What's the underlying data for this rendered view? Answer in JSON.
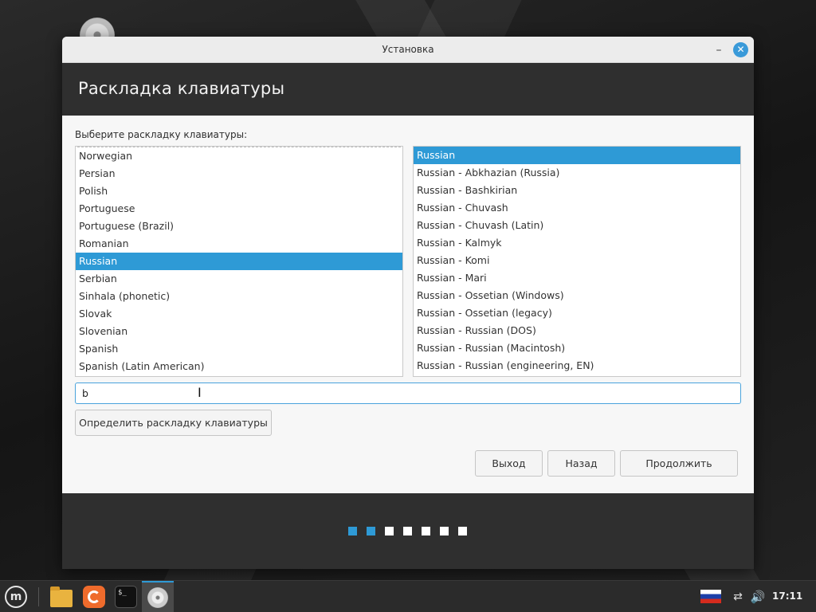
{
  "window": {
    "title": "Установка",
    "minimize_glyph": "–",
    "close_glyph": "✕"
  },
  "header": {
    "title": "Раскладка клавиатуры"
  },
  "content": {
    "prompt": "Выберите раскладку клавиатуры:",
    "layouts": [
      "Norwegian",
      "Persian",
      "Polish",
      "Portuguese",
      "Portuguese (Brazil)",
      "Romanian",
      "Russian",
      "Serbian",
      "Sinhala (phonetic)",
      "Slovak",
      "Slovenian",
      "Spanish",
      "Spanish (Latin American)"
    ],
    "selected_layout": "Russian",
    "variants": [
      "Russian",
      "Russian - Abkhazian (Russia)",
      "Russian - Bashkirian",
      "Russian - Chuvash",
      "Russian - Chuvash (Latin)",
      "Russian - Kalmyk",
      "Russian - Komi",
      "Russian - Mari",
      "Russian - Ossetian (Windows)",
      "Russian - Ossetian (legacy)",
      "Russian - Russian (DOS)",
      "Russian - Russian (Macintosh)",
      "Russian - Russian (engineering, EN)"
    ],
    "selected_variant": "Russian",
    "test_input_value": "b",
    "detect_button": "Определить раскладку клавиатуры"
  },
  "buttons": {
    "quit": "Выход",
    "back": "Назад",
    "continue": "Продолжить"
  },
  "progress": {
    "total_steps": 7,
    "completed_steps": 2
  },
  "colors": {
    "accent": "#2e9ad6",
    "header_band": "#2f2f2f"
  },
  "taskbar": {
    "clock": "17:11",
    "icons": [
      "mint-menu-icon",
      "folder-icon",
      "firefox-icon",
      "terminal-icon",
      "disc-icon",
      "russian-flag-icon",
      "network-icon",
      "volume-icon"
    ],
    "terminal_glyph": "$_",
    "mint_glyph": "m"
  }
}
